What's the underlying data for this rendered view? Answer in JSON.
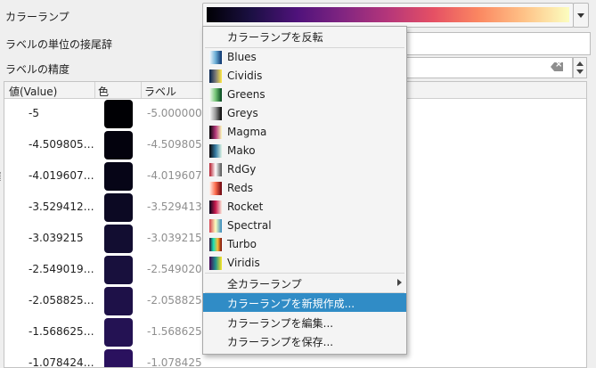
{
  "form": {
    "color_ramp_label": "カラーランプ",
    "suffix_label": "ラベルの単位の接尾辞",
    "precision_label": "ラベルの精度",
    "suffix_value": "",
    "precision_value": ""
  },
  "table": {
    "headers": [
      "値(Value)",
      "色",
      "ラベル"
    ],
    "rows": [
      {
        "value": "-5",
        "label": "-5.000000",
        "color": "#000004"
      },
      {
        "value": "-4.509805…",
        "label": "-4.509805",
        "color": "#03020d"
      },
      {
        "value": "-4.019607…",
        "label": "-4.019607",
        "color": "#060517"
      },
      {
        "value": "-3.529412…",
        "label": "-3.529413",
        "color": "#0c0923"
      },
      {
        "value": "-3.039215",
        "label": "-3.039215",
        "color": "#120d31"
      },
      {
        "value": "-2.549019…",
        "label": "-2.549020",
        "color": "#18103d"
      },
      {
        "value": "-2.058825…",
        "label": "-2.058825",
        "color": "#1e1148"
      },
      {
        "value": "-1.568625…",
        "label": "-1.568625",
        "color": "#241253"
      },
      {
        "value": "-1.078424…",
        "label": "-1.078425",
        "color": "#2a115e"
      }
    ]
  },
  "menu": {
    "invert": "カラーランプを反転",
    "ramps": [
      {
        "name": "Blues",
        "icon": "blues-ramp-icon",
        "colors": [
          "#f7fbff",
          "#6baed6",
          "#08306b"
        ]
      },
      {
        "name": "Cividis",
        "icon": "cividis-ramp-icon",
        "colors": [
          "#00204c",
          "#7c7b78",
          "#ffe945"
        ]
      },
      {
        "name": "Greens",
        "icon": "greens-ramp-icon",
        "colors": [
          "#f7fcf5",
          "#74c476",
          "#00441b"
        ]
      },
      {
        "name": "Greys",
        "icon": "greys-ramp-icon",
        "colors": [
          "#ffffff",
          "#969696",
          "#000000"
        ]
      },
      {
        "name": "Magma",
        "icon": "magma-ramp-icon",
        "colors": [
          "#000004",
          "#b5367a",
          "#fcfdbf"
        ]
      },
      {
        "name": "Mako",
        "icon": "mako-ramp-icon",
        "colors": [
          "#0b0405",
          "#357ba3",
          "#def5e5"
        ]
      },
      {
        "name": "RdGy",
        "icon": "rdgy-ramp-icon",
        "colors": [
          "#b2182b",
          "#ffffff",
          "#4d4d4d"
        ]
      },
      {
        "name": "Reds",
        "icon": "reds-ramp-icon",
        "colors": [
          "#fff5f0",
          "#fb6a4a",
          "#67000d"
        ]
      },
      {
        "name": "Rocket",
        "icon": "rocket-ramp-icon",
        "colors": [
          "#03051a",
          "#cb1b4f",
          "#faebdd"
        ]
      },
      {
        "name": "Spectral",
        "icon": "spectral-ramp-icon",
        "colors": [
          "#d53e4f",
          "#ffffbf",
          "#3288bd"
        ]
      },
      {
        "name": "Turbo",
        "icon": "turbo-ramp-icon",
        "colors": [
          "#30123b",
          "#1ae4b6",
          "#fabb39",
          "#7a0403"
        ]
      },
      {
        "name": "Viridis",
        "icon": "viridis-ramp-icon",
        "colors": [
          "#440154",
          "#21918c",
          "#fde725"
        ]
      }
    ],
    "all_ramps": "全カラーランプ",
    "new_ramp": "カラーランプを新規作成...",
    "edit_ramp": "カラーランプを編集...",
    "save_ramp": "カラーランプを保存..."
  },
  "colors": {
    "highlight": "#308cc6",
    "ramp_gradient": [
      "#000004",
      "#4f127b",
      "#b5367a",
      "#fb8761",
      "#fcfdbf"
    ]
  }
}
